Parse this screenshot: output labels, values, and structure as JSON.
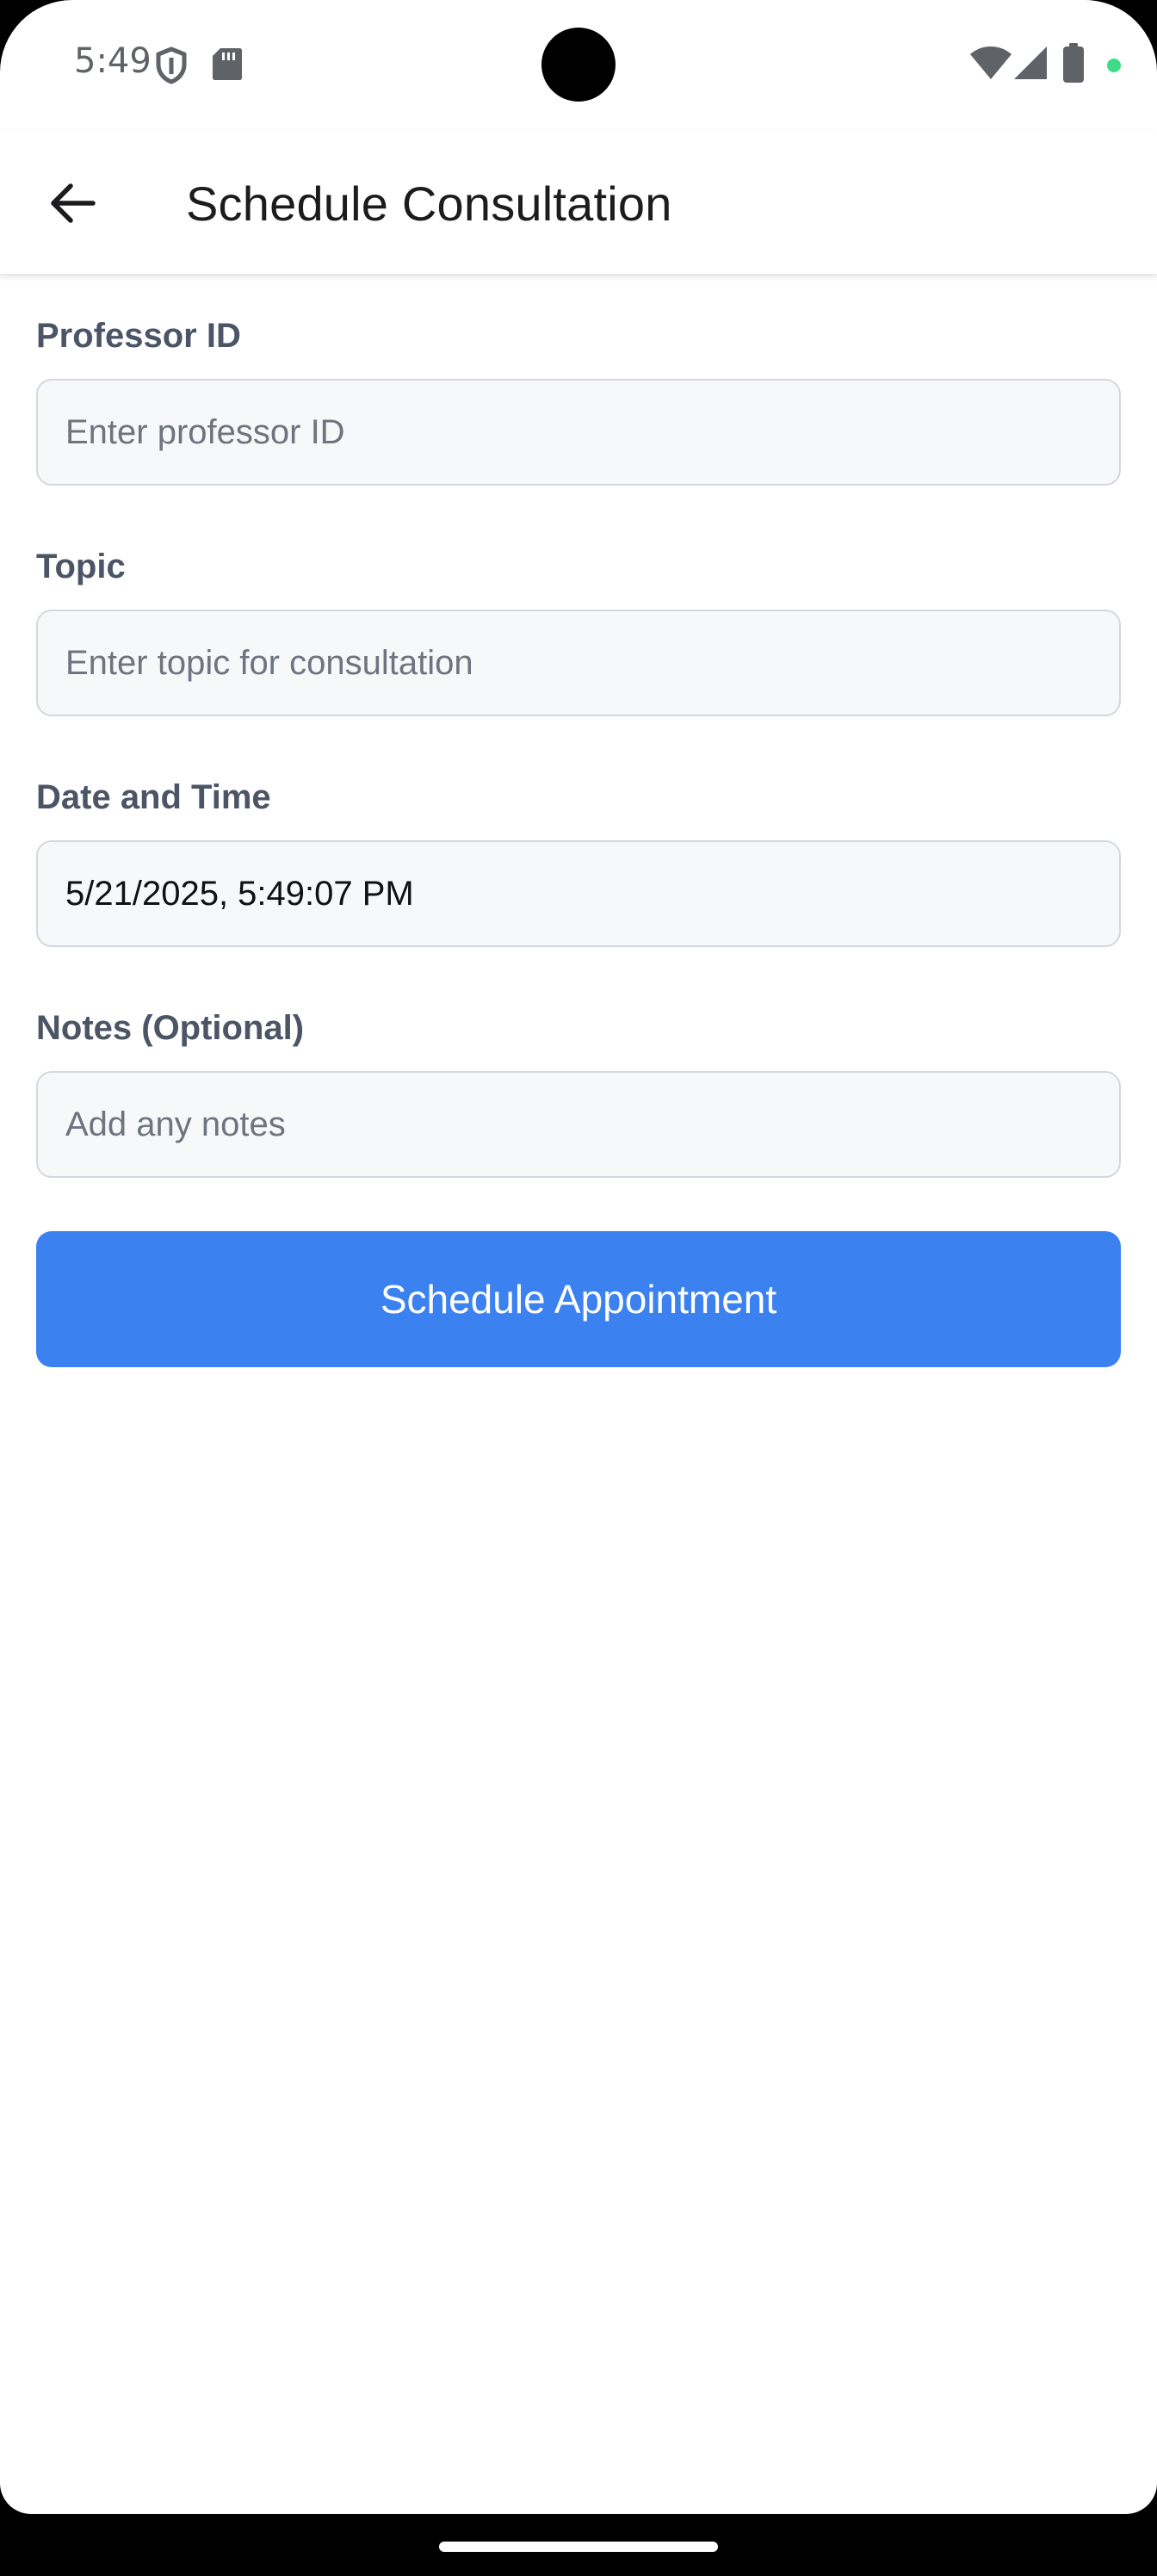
{
  "status_bar": {
    "time": "5:49",
    "icons": [
      "shield-icon",
      "sd-card-icon",
      "wifi-icon",
      "signal-icon",
      "battery-icon",
      "privacy-dot"
    ],
    "privacy_dot_color": "#3ddc84"
  },
  "app_bar": {
    "back_icon": "arrow-left-icon",
    "title": "Schedule Consultation"
  },
  "form": {
    "professor_id": {
      "label": "Professor ID",
      "placeholder": "Enter professor ID",
      "value": ""
    },
    "topic": {
      "label": "Topic",
      "placeholder": "Enter topic for consultation",
      "value": ""
    },
    "date_time": {
      "label": "Date and Time",
      "placeholder": "",
      "value": "5/21/2025, 5:49:07 PM"
    },
    "notes": {
      "label": "Notes (Optional)",
      "placeholder": "Add any notes",
      "value": ""
    },
    "submit_label": "Schedule Appointment"
  },
  "colors": {
    "accent": "#3b82f0",
    "label": "#4b5566",
    "input_background": "#f7f8fa",
    "input_border": "#d4d7dd"
  }
}
